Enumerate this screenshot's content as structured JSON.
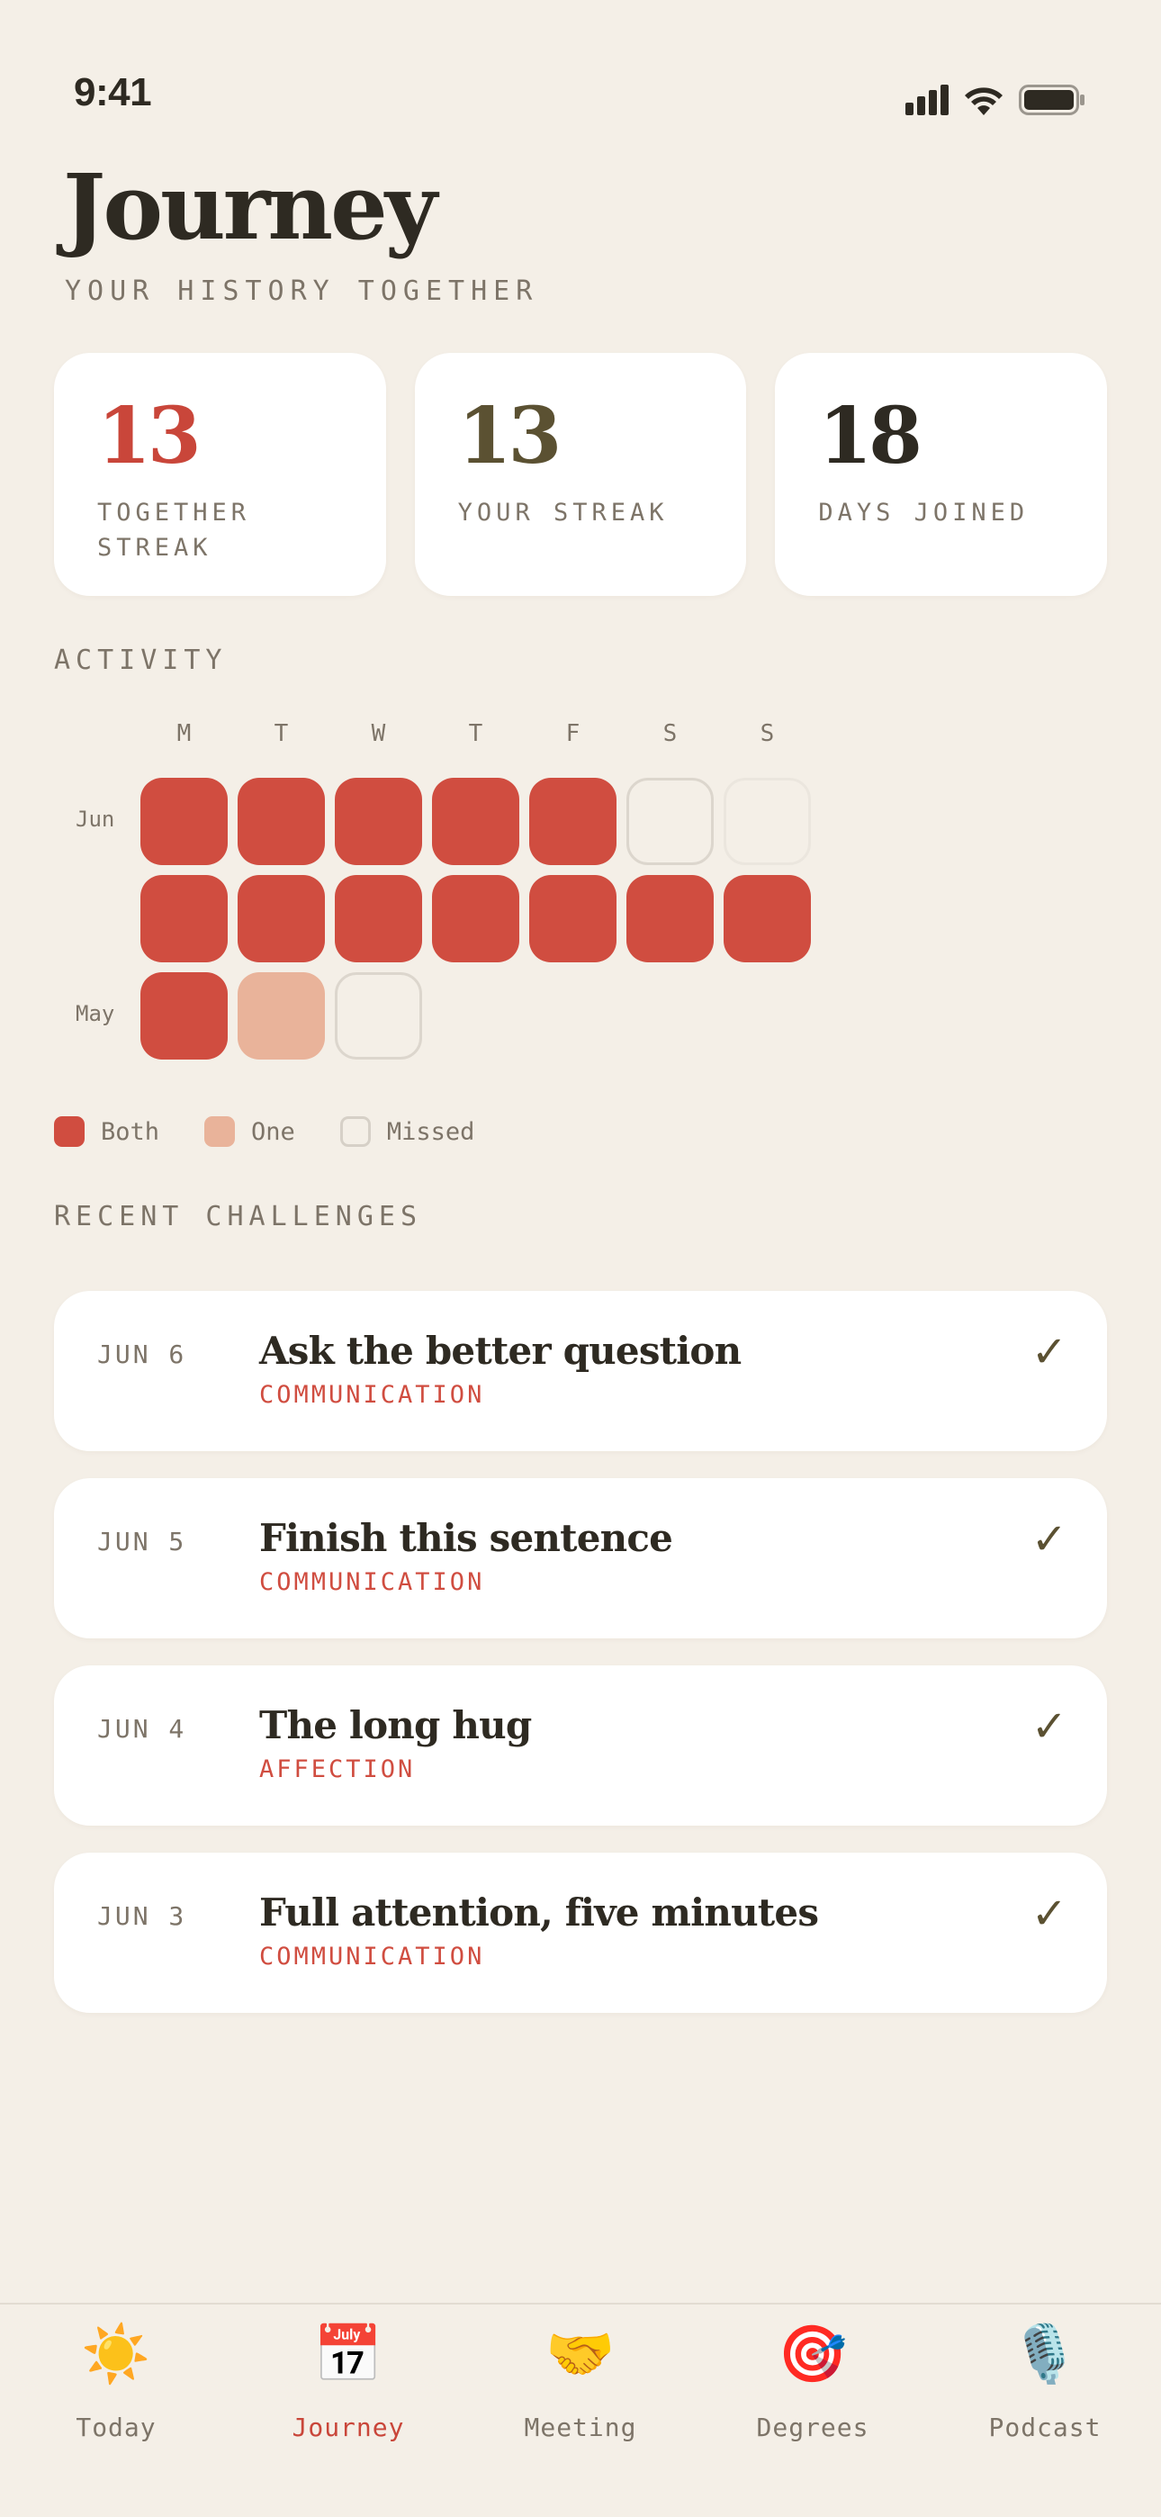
{
  "status_bar": {
    "time": "9:41"
  },
  "header": {
    "title": "Journey",
    "subtitle": "YOUR HISTORY TOGETHER"
  },
  "stats": [
    {
      "value": "13",
      "label": "TOGETHER STREAK",
      "color": "#c9463a"
    },
    {
      "value": "13",
      "label": "YOUR STREAK",
      "color": "#5b5132"
    },
    {
      "value": "18",
      "label": "DAYS JOINED",
      "color": "#2e2a22"
    }
  ],
  "activity": {
    "label": "ACTIVITY",
    "day_headers": [
      "M",
      "T",
      "W",
      "T",
      "F",
      "S",
      "S"
    ],
    "rows": [
      {
        "label": "Jun",
        "cells": [
          "both",
          "both",
          "both",
          "both",
          "both",
          "missed",
          "future"
        ]
      },
      {
        "label": "",
        "cells": [
          "both",
          "both",
          "both",
          "both",
          "both",
          "both",
          "both"
        ]
      },
      {
        "label": "May",
        "cells": [
          "both",
          "one",
          "missed"
        ]
      }
    ],
    "legend": [
      {
        "key": "both",
        "label": "Both"
      },
      {
        "key": "one",
        "label": "One"
      },
      {
        "key": "missed",
        "label": "Missed"
      }
    ]
  },
  "recent": {
    "label": "RECENT CHALLENGES",
    "items": [
      {
        "date": "JUN 6",
        "title": "Ask the better question",
        "category": "COMMUNICATION",
        "done": "✓"
      },
      {
        "date": "JUN 5",
        "title": "Finish this sentence",
        "category": "COMMUNICATION",
        "done": "✓"
      },
      {
        "date": "JUN 4",
        "title": "The long hug",
        "category": "AFFECTION",
        "done": "✓"
      },
      {
        "date": "JUN 3",
        "title": "Full attention, five minutes",
        "category": "COMMUNICATION",
        "done": "✓"
      }
    ]
  },
  "tabs": [
    {
      "label": "Today",
      "icon": "☀️",
      "icon_name": "sun-icon",
      "active": false
    },
    {
      "label": "Journey",
      "icon": "📅",
      "icon_name": "calendar-icon",
      "active": true
    },
    {
      "label": "Meeting",
      "icon": "🤝",
      "icon_name": "handshake-icon",
      "active": false
    },
    {
      "label": "Degrees",
      "icon": "🎯",
      "icon_name": "target-icon",
      "active": false
    },
    {
      "label": "Podcast",
      "icon": "🎙️",
      "icon_name": "microphone-icon",
      "active": false
    }
  ],
  "colors": {
    "accent": "#d04d40",
    "one": "#e9b39a",
    "background": "#f4efe7"
  }
}
